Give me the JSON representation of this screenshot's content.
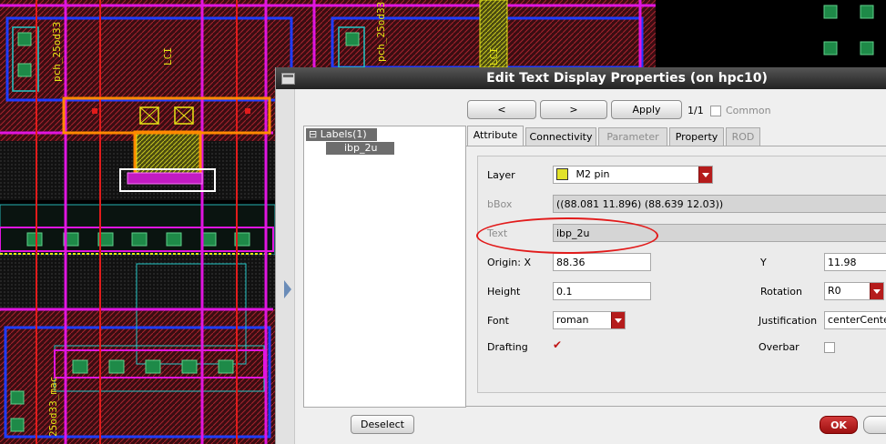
{
  "dialog": {
    "title": "Edit Text Display Properties (on hpc10)",
    "nav": {
      "prev_label": "<",
      "next_label": ">",
      "apply_label": "Apply",
      "counter": "1/1",
      "common_label": "Common"
    },
    "tree": {
      "root_label": "Labels(1)",
      "child_label": "ibp_2u",
      "expander": "⊟"
    },
    "tabs": [
      {
        "label": "Attribute",
        "active": true,
        "enabled": true
      },
      {
        "label": "Connectivity",
        "active": false,
        "enabled": true
      },
      {
        "label": "Parameter",
        "active": false,
        "enabled": false
      },
      {
        "label": "Property",
        "active": false,
        "enabled": true
      },
      {
        "label": "ROD",
        "active": false,
        "enabled": false
      }
    ],
    "attribute": {
      "layer_label": "Layer",
      "layer_value": "M2 pin",
      "layer_color": "#e2e22a",
      "bbox_label": "bBox",
      "bbox_value": "((88.081 11.896) (88.639 12.03))",
      "text_label": "Text",
      "text_value": "ibp_2u",
      "origin_label": "Origin:  X",
      "origin_x": "88.36",
      "y_label": "Y",
      "origin_y": "11.98",
      "height_label": "Height",
      "height_value": "0.1",
      "rotation_label": "Rotation",
      "rotation_value": "R0",
      "font_label": "Font",
      "font_value": "roman",
      "justification_label": "Justification",
      "justification_value": "centerCenter",
      "drafting_label": "Drafting",
      "drafting_checked": true,
      "overbar_label": "Overbar",
      "overbar_checked": false
    },
    "deselect_label": "Deselect",
    "ok_label": "OK"
  },
  "layout_view": {
    "labels": [
      "pch_25od33",
      "pch_25od33",
      "LCI",
      "LCI",
      "25od33_mac"
    ],
    "colors": {
      "red": "#e21b1b",
      "magenta": "#e015e0",
      "blue": "#1f3cff",
      "orange": "#ff8a00",
      "yellow": "#e7e715",
      "cyan": "#22c8c8",
      "green": "#27a85a"
    }
  }
}
